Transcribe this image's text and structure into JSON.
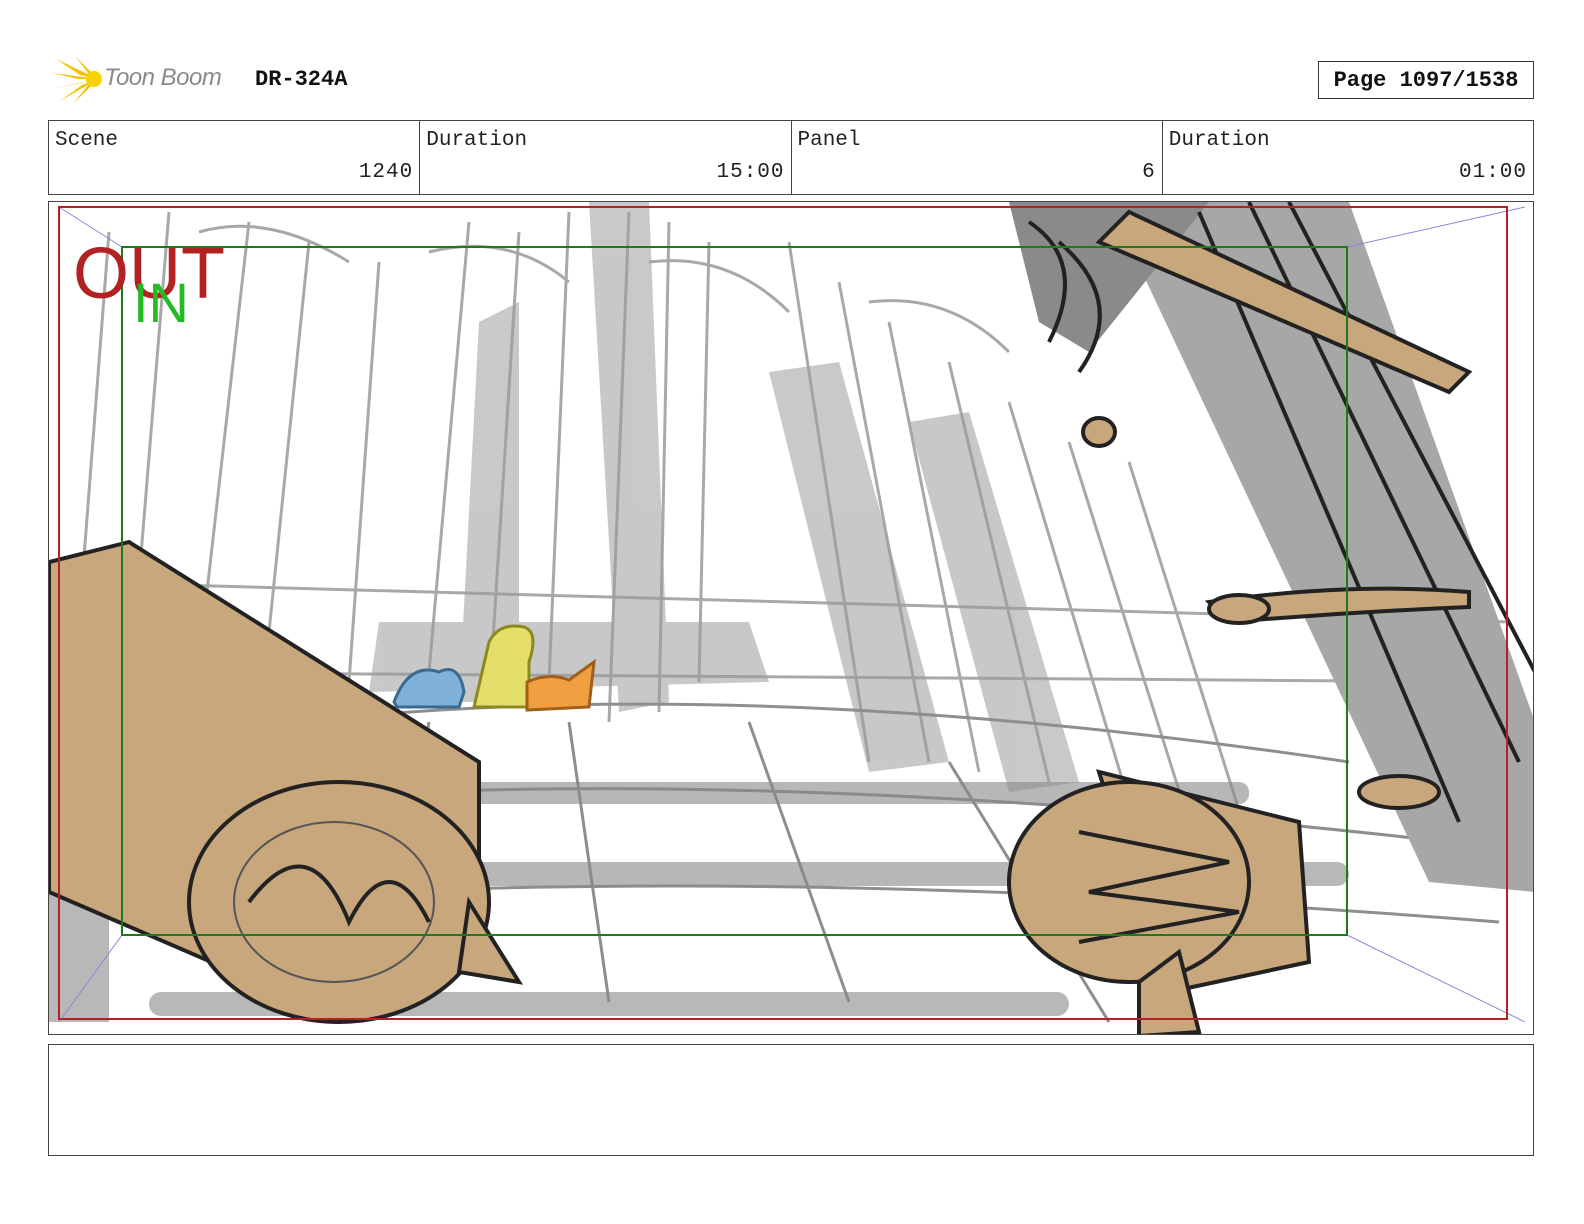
{
  "header": {
    "logo_text": "Toon Boom",
    "production_code": "DR-324A",
    "page_label": "Page 1097/1538"
  },
  "info": {
    "scene_label": "Scene",
    "scene_value": "1240",
    "scene_duration_label": "Duration",
    "scene_duration_value": "15:00",
    "panel_label": "Panel",
    "panel_value": "6",
    "panel_duration_label": "Duration",
    "panel_duration_value": "01:00"
  },
  "panel": {
    "out_label": "OUT",
    "in_label": "IN",
    "colors": {
      "out_frame": "#b22222",
      "in_frame": "#1f7a1f",
      "log": "#c9a77c",
      "sketch_gray": "#9a9a9a",
      "blue_character": "#7fb1d9",
      "yellow_character": "#e6de6a",
      "orange_character": "#f0a040"
    }
  },
  "notes": {
    "text": ""
  }
}
